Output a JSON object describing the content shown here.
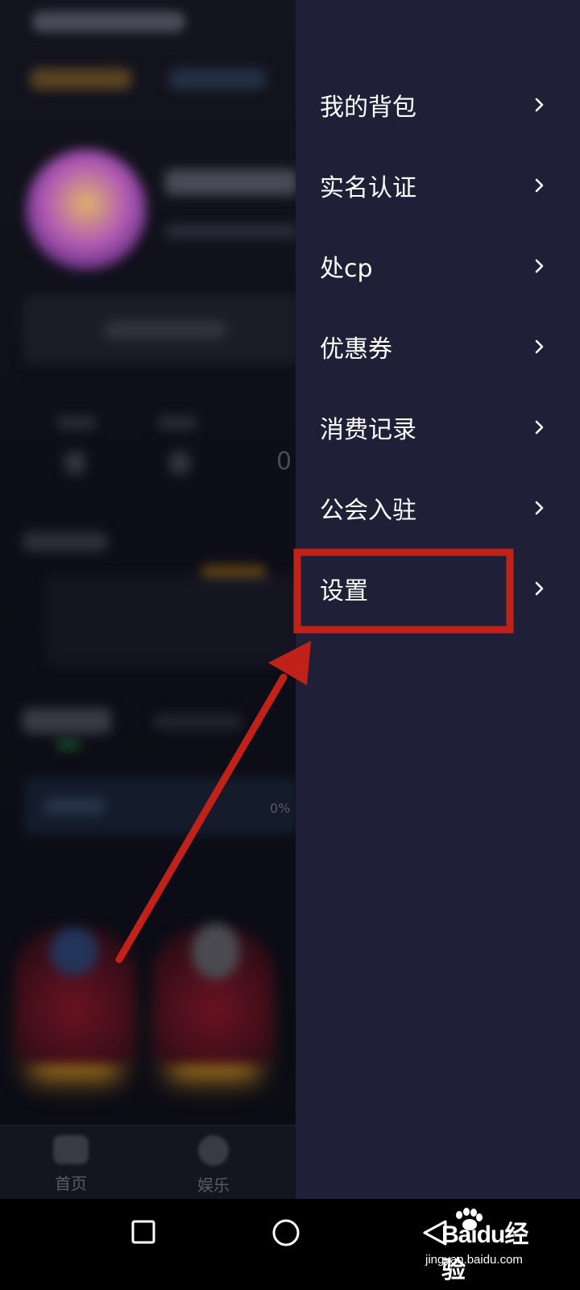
{
  "drawer": {
    "items": [
      {
        "label": "我的背包",
        "icon": "chevron-right-icon"
      },
      {
        "label": "实名认证",
        "icon": "chevron-right-icon"
      },
      {
        "label": "处cp",
        "icon": "chevron-right-icon"
      },
      {
        "label": "优惠券",
        "icon": "chevron-right-icon"
      },
      {
        "label": "消费记录",
        "icon": "chevron-right-icon"
      },
      {
        "label": "公会入驻",
        "icon": "chevron-right-icon"
      },
      {
        "label": "设置",
        "icon": "chevron-right-icon",
        "highlighted": true
      }
    ],
    "background_color": "#1f1f38"
  },
  "background_app": {
    "stats_value": "0",
    "progress_label": "0%",
    "tabs": [
      {
        "label": "首页",
        "icon": "home-icon"
      },
      {
        "label": "娱乐",
        "icon": "entertainment-icon"
      }
    ]
  },
  "annotation": {
    "color": "#c0221a",
    "highlight_target": "设置"
  },
  "system_nav": {
    "buttons": [
      "recents-square-icon",
      "home-circle-icon",
      "back-triangle-icon"
    ]
  },
  "watermark": {
    "main": "Baidu经验",
    "sub": "jingyan.baidu.com"
  }
}
